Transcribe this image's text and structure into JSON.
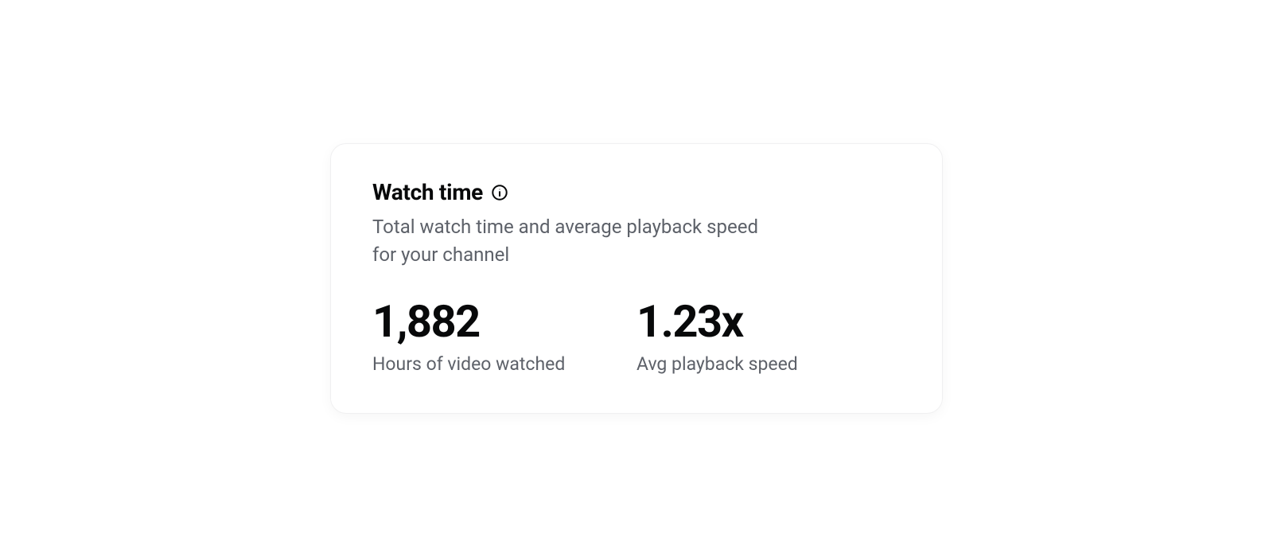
{
  "card": {
    "title": "Watch time",
    "subtitle": "Total watch time and average playback speed for your channel",
    "metrics": [
      {
        "value": "1,882",
        "label": "Hours of video watched"
      },
      {
        "value": "1.23x",
        "label": "Avg playback speed"
      }
    ]
  }
}
